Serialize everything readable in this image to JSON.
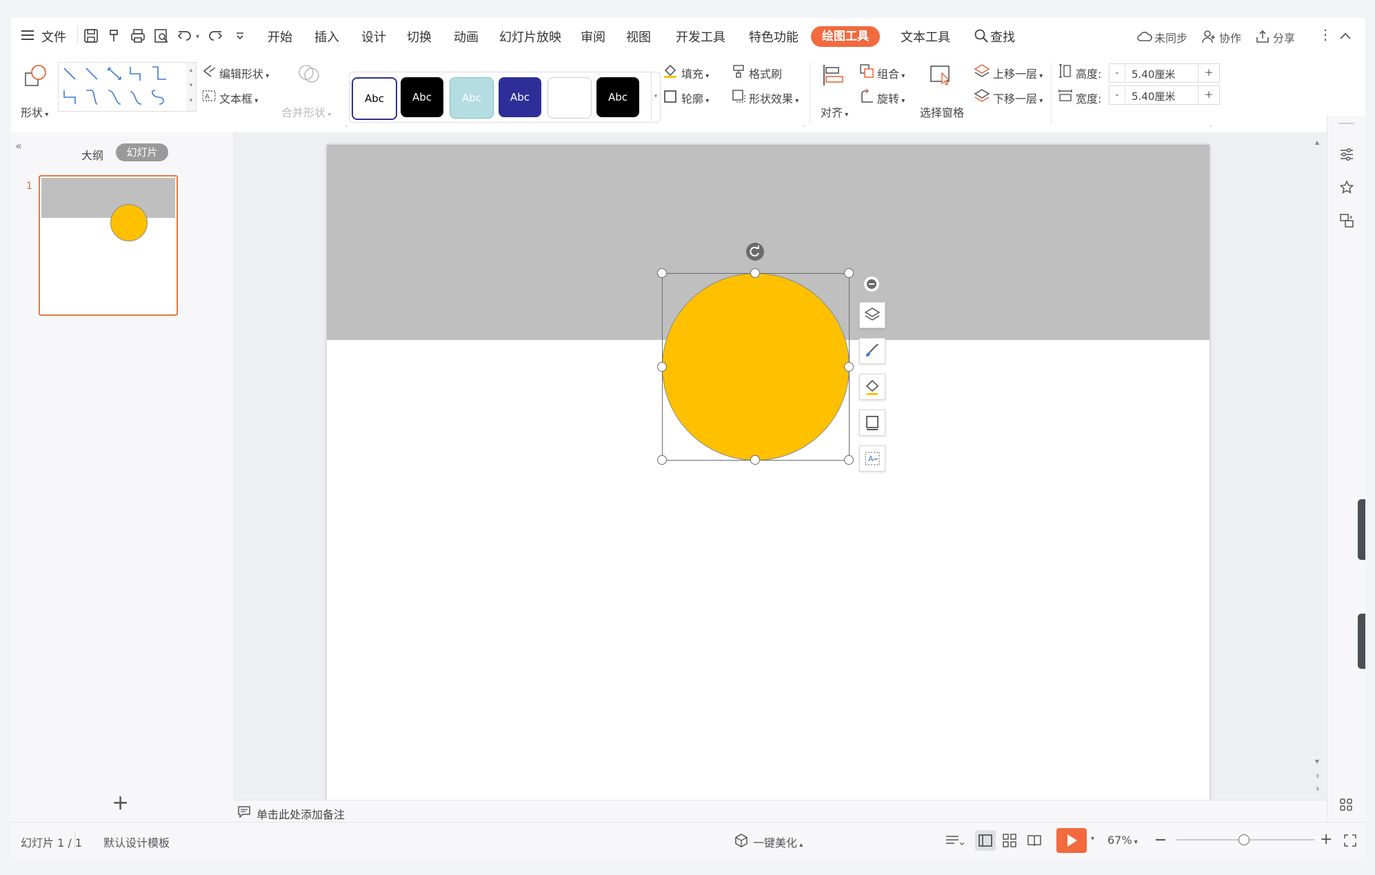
{
  "menu": {
    "file": "文件",
    "items": [
      "开始",
      "插入",
      "设计",
      "切换",
      "动画",
      "幻灯片放映",
      "审阅",
      "视图",
      "开发工具",
      "特色功能"
    ],
    "active_tab": "绘图工具",
    "text_tool": "文本工具",
    "search": "查找",
    "unsync": "未同步",
    "collab": "协作",
    "share": "分享"
  },
  "ribbon": {
    "shapes": "形状",
    "edit_shape": "编辑形状",
    "textbox": "文本框",
    "merge_shape": "合并形状",
    "style_label": "Abc",
    "fill": "填充",
    "format_painter": "格式刷",
    "outline": "轮廓",
    "shape_effect": "形状效果",
    "align": "对齐",
    "group": "组合",
    "rotate": "旋转",
    "select_pane": "选择窗格",
    "bring_forward": "上移一层",
    "send_backward": "下移一层",
    "height_label": "高度:",
    "height_value": "5.40厘米",
    "width_label": "宽度:",
    "width_value": "5.40厘米",
    "minus": "-",
    "plus": "+"
  },
  "left_panel": {
    "tab_outline": "大纲",
    "tab_slides": "幻灯片",
    "slide_number": "1",
    "add_slide": "+"
  },
  "notes_placeholder": "单击此处添加备注",
  "status": {
    "slide_count": "幻灯片 1 / 1",
    "template": "默认设计模板",
    "beautify": "一键美化",
    "zoom": "67%"
  },
  "colors": {
    "accent": "#f26a3d",
    "circle": "#ffc000",
    "banner": "#bfbfbf"
  }
}
